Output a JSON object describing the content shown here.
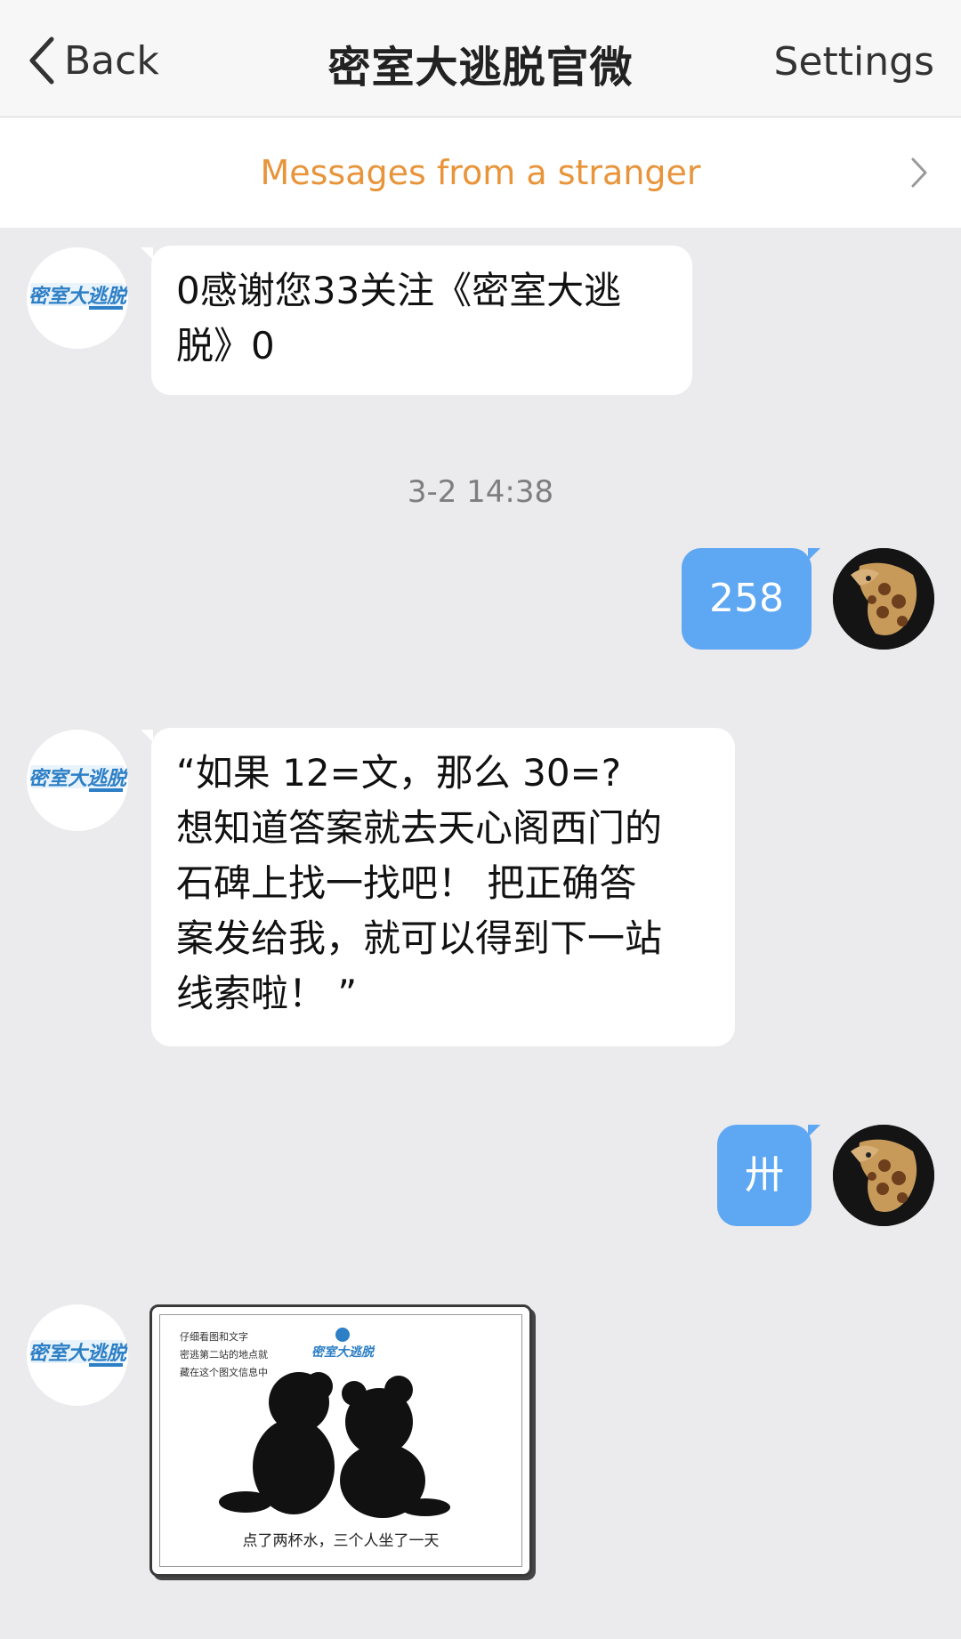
{
  "nav": {
    "back_label": "Back",
    "title": "密室大逃脱官微",
    "settings_label": "Settings"
  },
  "banner": {
    "text": "Messages from a stranger"
  },
  "messages": [
    {
      "sender": "official",
      "text": "0感谢您33关注《密室大逃\n脱》0"
    },
    {
      "sender": "self",
      "text": "258"
    },
    {
      "sender": "official",
      "text": "“如果 12=文，那么 30=?\n想知道答案就去天心阁西门的\n石碑上找一找吧！ 把正确答\n案发给我，就可以得到下一站\n线索啦！ ”"
    },
    {
      "sender": "self",
      "text": "卅"
    },
    {
      "sender": "official",
      "type": "image",
      "image_lines": [
        "仔细看图和文字",
        "密逃第二站的地点就",
        "藏在这个图文信息中"
      ],
      "image_caption": "点了两杯水，三个人坐了一天",
      "image_logo": "密室大逃脱"
    }
  ],
  "timestamp": "3-2 14:38",
  "avatar_logo_text": "密室大逃脱",
  "colors": {
    "accent_orange": "#e8943a",
    "outgoing_bubble": "#5ea7f2",
    "background": "#ebebed"
  },
  "icons": {
    "back": "chevron-left-icon",
    "banner": "chevron-right-icon"
  }
}
